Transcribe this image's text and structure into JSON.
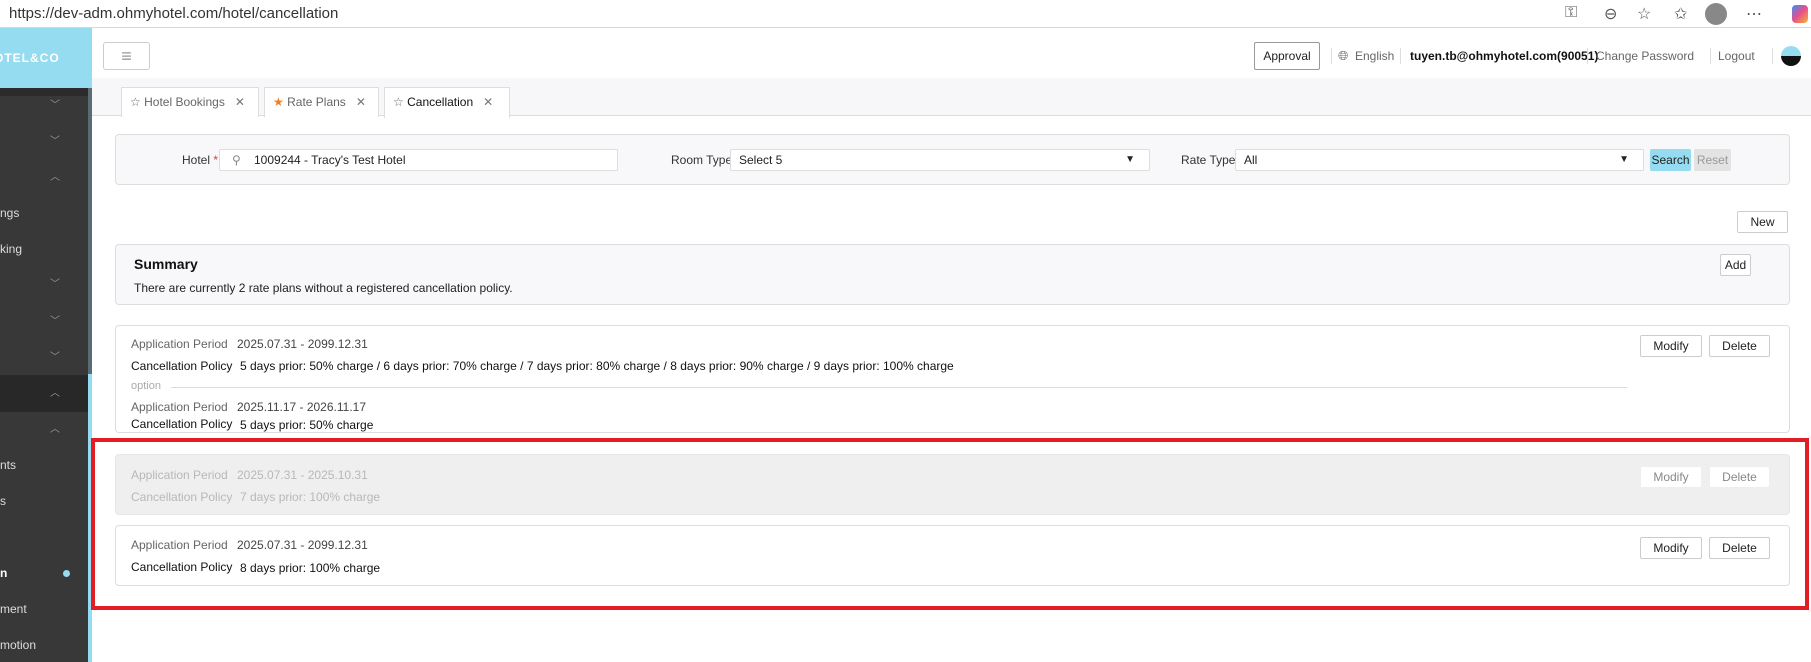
{
  "browser": {
    "url": "https://dev-adm.ohmyhotel.com/hotel/cancellation"
  },
  "sidebar": {
    "logo": "OTEL&CO",
    "items": [
      {
        "label": "",
        "state": "collapsed"
      },
      {
        "label": "",
        "state": "collapsed"
      },
      {
        "label": "",
        "state": "expanded"
      },
      {
        "label": "ngs"
      },
      {
        "label": "king"
      },
      {
        "label": "",
        "state": "collapsed"
      },
      {
        "label": "",
        "state": "collapsed"
      },
      {
        "label": "",
        "state": "collapsed"
      },
      {
        "label": "",
        "state": "expanded"
      },
      {
        "label": "",
        "state": "expanded"
      },
      {
        "label": "nts"
      },
      {
        "label": "s"
      },
      {
        "label": ""
      },
      {
        "label": "n"
      },
      {
        "label": "ment"
      },
      {
        "label": "motion"
      }
    ]
  },
  "header": {
    "approval": "Approval",
    "language": "English",
    "user": "tuyen.tb@ohmyhotel.com(90051)",
    "change_password": "Change Password",
    "logout": "Logout"
  },
  "tabs": [
    {
      "label": "Hotel Bookings",
      "starred": false
    },
    {
      "label": "Rate Plans",
      "starred": true
    },
    {
      "label": "Cancellation",
      "starred": false,
      "active": true
    }
  ],
  "filters": {
    "hotel_label": "Hotel",
    "required": "*",
    "hotel_value": "1009244 - Tracy's Test Hotel",
    "room_type_label": "Room Type",
    "room_type_value": "Select 5",
    "rate_type_label": "Rate Type",
    "rate_type_value": "All",
    "search": "Search",
    "reset": "Reset"
  },
  "new_button": "New",
  "summary": {
    "title": "Summary",
    "text": "There are currently 2 rate plans without a registered cancellation policy.",
    "add": "Add"
  },
  "labels": {
    "period": "Application Period",
    "policy": "Cancellation Policy",
    "option": "option",
    "modify": "Modify",
    "delete": "Delete"
  },
  "policies": [
    {
      "period": "2025.07.31 - 2099.12.31",
      "policy": "5 days prior: 50% charge / 6 days prior: 70% charge / 7 days prior: 80% charge / 8 days prior: 90% charge / 9 days prior: 100% charge",
      "option": {
        "period": "2025.11.17 - 2026.11.17",
        "policy": "5 days prior: 50% charge"
      }
    },
    {
      "period": "2025.07.31 - 2025.10.31",
      "policy": "7 days prior: 100% charge",
      "disabled": true
    },
    {
      "period": "2025.07.31 - 2099.12.31",
      "policy": "8 days prior: 100% charge"
    }
  ],
  "colors": {
    "accent": "#95dcf0",
    "sidebar": "#383838",
    "highlight": "#e21e24"
  }
}
